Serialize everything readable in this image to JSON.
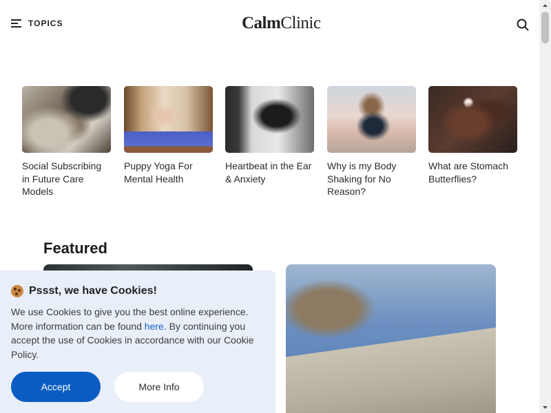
{
  "header": {
    "menu_label": "TOPICS",
    "logo_bold": "Calm",
    "logo_regular": "Clinic",
    "menu_icon": "hamburger-icon",
    "search_icon": "search-icon"
  },
  "topics": [
    {
      "title": "Social Subscribing in Future Care Models"
    },
    {
      "title": "Puppy Yoga For Mental Health"
    },
    {
      "title": "Heartbeat in the Ear & Anxiety"
    },
    {
      "title": "Why is my Body Shaking for No Reason?"
    },
    {
      "title": "What are Stomach Butterflies?"
    }
  ],
  "featured": {
    "heading": "Featured"
  },
  "cookie_banner": {
    "title": "Pssst, we have Cookies!",
    "icon": "cookie-icon",
    "text_before_link": "We use Cookies to give you the best online experience. More information can be found ",
    "link_text": "here",
    "text_after_link": ". By continuing you accept the use of Cookies in accordance with our Cookie Policy.",
    "accept_label": "Accept",
    "more_info_label": "More Info",
    "accept_color": "#0b5cc2",
    "background_color": "#e9eff9"
  }
}
